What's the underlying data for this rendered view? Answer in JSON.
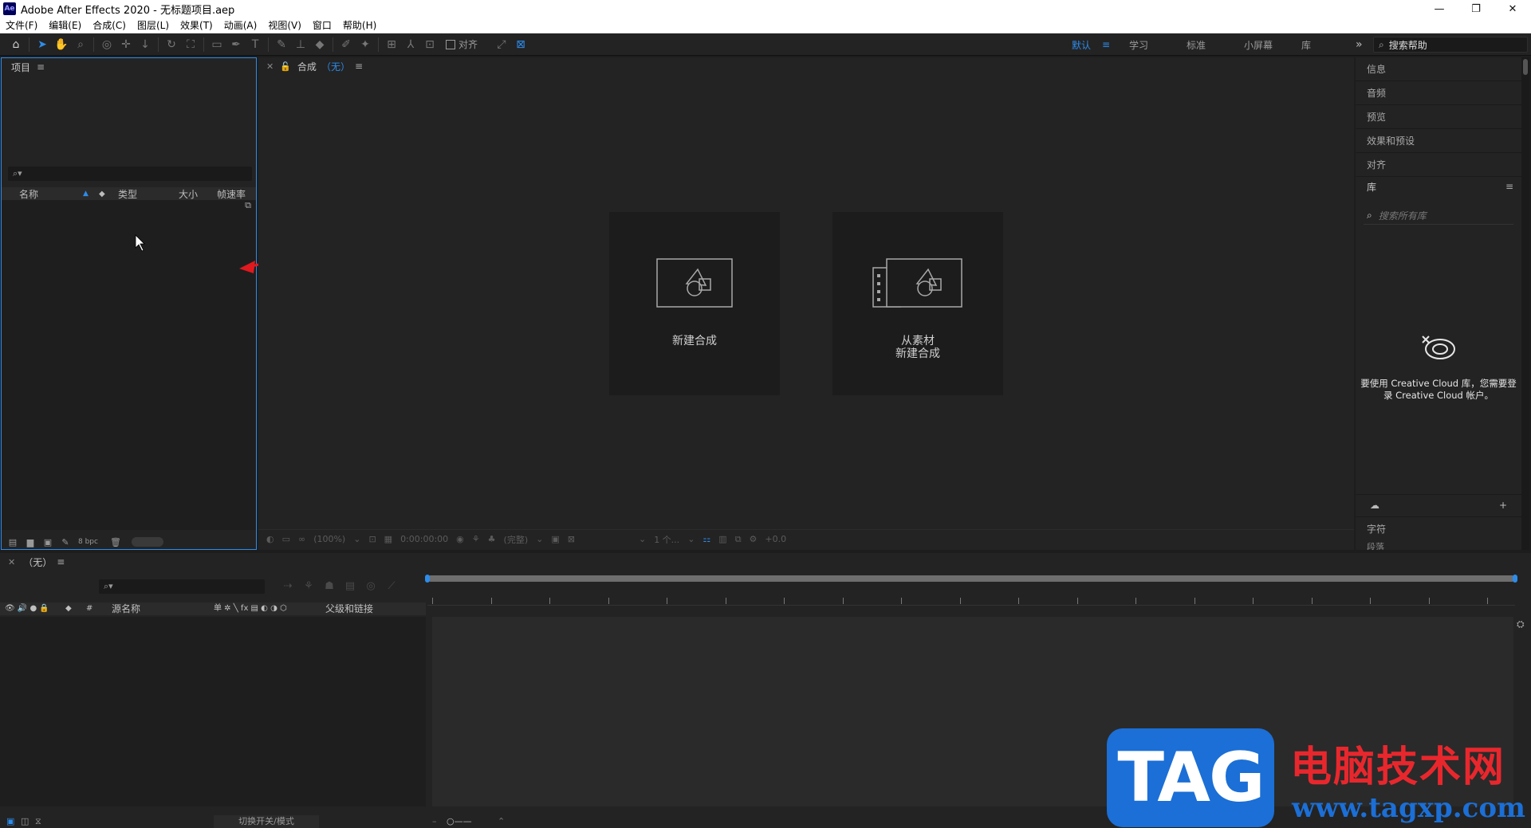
{
  "window": {
    "logo": "Ae",
    "title": "Adobe After Effects 2020 - 无标题项目.aep",
    "controls": [
      "—",
      "❐",
      "✕"
    ]
  },
  "menu": [
    "文件(F)",
    "编辑(E)",
    "合成(C)",
    "图层(L)",
    "效果(T)",
    "动画(A)",
    "视图(V)",
    "窗口",
    "帮助(H)"
  ],
  "toolbar": {
    "snap_label": "对齐",
    "workspaces": [
      "默认",
      "学习",
      "标准",
      "小屏幕",
      "库"
    ],
    "active_workspace": "默认",
    "more": "»",
    "help_search": "搜索帮助"
  },
  "project_panel": {
    "title": "项目",
    "columns": {
      "name": "名称",
      "type": "类型",
      "size": "大小",
      "fps": "帧速率"
    },
    "bpc": "8 bpc"
  },
  "comp_panel": {
    "title": "合成",
    "comp_name": "（无）",
    "cards": {
      "new_comp": "新建合成",
      "from_footage_line1": "从素材",
      "from_footage_line2": "新建合成"
    },
    "footer": {
      "zoom": "(100%)",
      "timecode": "0:00:00:00",
      "quality": "(完整)",
      "views": "1 个...",
      "exposure": "+0.0"
    }
  },
  "right_panel": {
    "items": [
      "信息",
      "音频",
      "预览",
      "效果和预设",
      "对齐"
    ],
    "library": {
      "title": "库",
      "search_placeholder": "搜索所有库",
      "message_line1": "要使用 Creative Cloud 库，您需要登",
      "message_line2": "录 Creative Cloud 帐户。"
    },
    "character": "字符",
    "paragraph": "段落"
  },
  "timeline": {
    "comp_name": "（无）",
    "columns": {
      "source_name": "源名称",
      "parent": "父级和链接",
      "switches": "单 ✲ ╲ fx ▤ ◐ ◑ ⬡"
    },
    "footer_mode": "切换开关/模式"
  },
  "watermark": {
    "tag": "TAG",
    "cn": "电脑技术网",
    "url": "www.tagxp.com"
  },
  "colors": {
    "accent": "#2d8ceb",
    "panel_bg": "#232323",
    "arrow": "#e0191f"
  }
}
